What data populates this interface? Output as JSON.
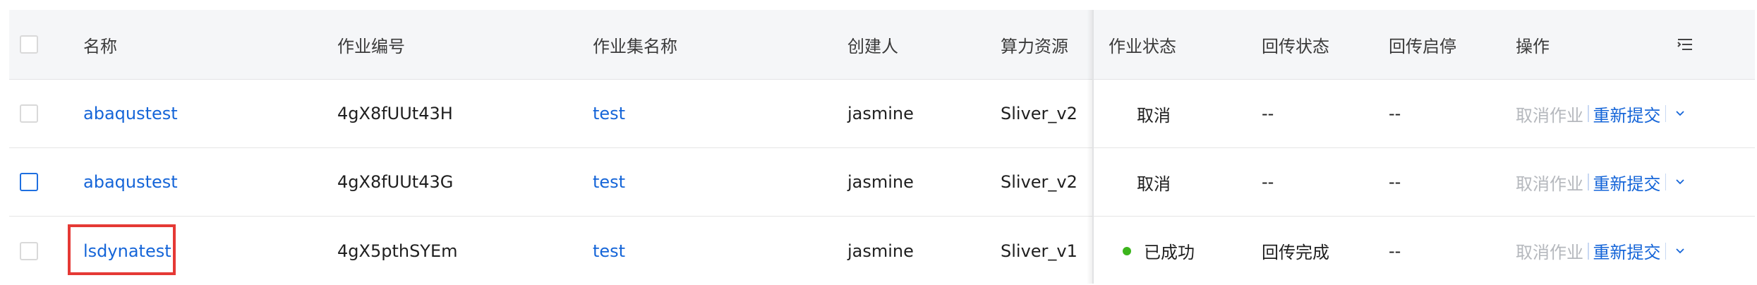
{
  "columns": {
    "name": "名称",
    "job_id": "作业编号",
    "jobset_name": "作业集名称",
    "creator": "创建人",
    "resource": "算力资源",
    "job_status": "作业状态",
    "return_status": "回传状态",
    "return_toggle": "回传启停",
    "actions": "操作"
  },
  "rows": [
    {
      "name": "abaqustest",
      "job_id": "4gX8fUUt43H",
      "jobset_name": "test",
      "creator": "jasmine",
      "resource": "Sliver_v2",
      "job_status": "取消",
      "return_status": "--",
      "return_toggle": "--",
      "action_cancel": "取消作业",
      "action_resubmit": "重新提交"
    },
    {
      "name": "abaqustest",
      "job_id": "4gX8fUUt43G",
      "jobset_name": "test",
      "creator": "jasmine",
      "resource": "Sliver_v2",
      "job_status": "取消",
      "return_status": "--",
      "return_toggle": "--",
      "action_cancel": "取消作业",
      "action_resubmit": "重新提交"
    },
    {
      "name": "lsdynatest",
      "job_id": "4gX5pthSYEm",
      "jobset_name": "test",
      "creator": "jasmine",
      "resource": "Sliver_v1",
      "job_status": "已成功",
      "return_status": "回传完成",
      "return_toggle": "--",
      "action_cancel": "取消作业",
      "action_resubmit": "重新提交"
    }
  ],
  "colors": {
    "link": "#1565d8",
    "success_dot": "#3cb51c",
    "highlight_box": "#e53935",
    "header_bg": "#f5f6f8"
  },
  "icons": {
    "column_settings": "column-settings-icon",
    "chevron": "chevron-down-icon"
  }
}
